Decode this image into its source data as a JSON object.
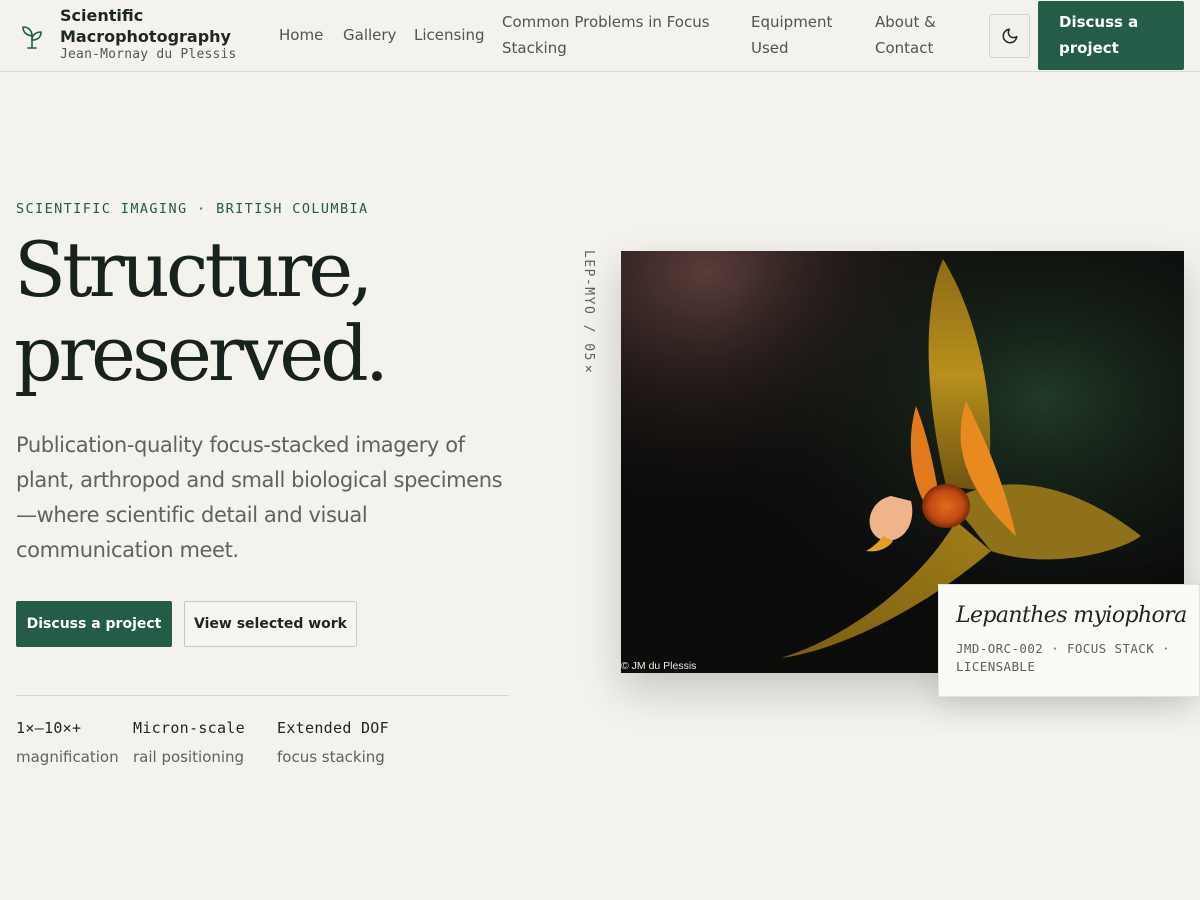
{
  "brand": {
    "title": "Scientific Macrophotography",
    "subtitle": "Jean-Mornay du Plessis",
    "icon": "sprout-icon"
  },
  "nav": {
    "items": [
      {
        "label": "Home"
      },
      {
        "label": "Gallery"
      },
      {
        "label": "Licensing"
      },
      {
        "label": "Common Problems in Focus Stacking"
      },
      {
        "label": "Equipment Used"
      },
      {
        "label": "About & Contact"
      }
    ],
    "theme_toggle_icon": "moon-icon",
    "cta_label": "Discuss a project"
  },
  "hero": {
    "eyebrow": "SCIENTIFIC IMAGING · BRITISH COLUMBIA",
    "headline_line1": "Structure,",
    "headline_line2": "preserved.",
    "lead": "Publication-quality focus-stacked imagery of plant, arthropod and small biological specimens—where scientific detail and visual communication meet.",
    "primary_button": "Discuss a project",
    "secondary_button": "View selected work",
    "stats": [
      {
        "value": "1×–10×+",
        "label": "magnification"
      },
      {
        "value": "Micron-scale",
        "label": "rail positioning"
      },
      {
        "value": "Extended DOF",
        "label": "focus stacking"
      }
    ]
  },
  "specimen": {
    "vertical_tag": "LEP-MYO / 05×",
    "copyright": "© JM du Plessis",
    "species": "Lepanthes myiophora",
    "meta": "JMD-ORC-002 · FOCUS STACK · LICENSABLE"
  },
  "colors": {
    "accent": "#245c47",
    "background": "#f3f2ed",
    "text": "#1d2623",
    "muted": "#5a6460"
  }
}
